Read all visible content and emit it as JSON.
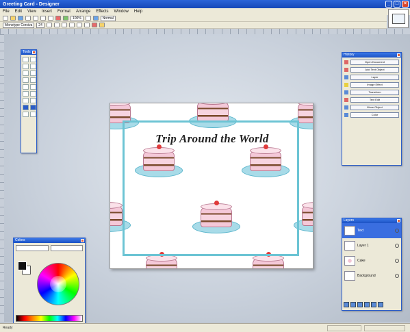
{
  "window": {
    "title": "Greeting Card - Designer",
    "controls": [
      "_",
      "□",
      "×"
    ]
  },
  "menu": [
    "File",
    "Edit",
    "View",
    "Insert",
    "Format",
    "Arrange",
    "Effects",
    "Window",
    "Help"
  ],
  "toolbar": {
    "font_name": "Monotype Corsiva",
    "font_size": "24",
    "zoom": "100%",
    "style": "Normal"
  },
  "canvas": {
    "title_text": "Trip Around the World",
    "frame_color": "#6cc4d4",
    "cake_frosting": "#f4c8d8",
    "plate_color": "#a8dbe8"
  },
  "panels": {
    "tools": {
      "title": "Tools"
    },
    "history": {
      "title": "History",
      "items": [
        {
          "label": "Open Document",
          "icon": "red"
        },
        {
          "label": "Add Text Object",
          "icon": "red"
        },
        {
          "label": "Layer",
          "icon": "blue"
        },
        {
          "label": "Image Effect",
          "icon": "yellow"
        },
        {
          "label": "Transform",
          "icon": "blue"
        },
        {
          "label": "Text Edit",
          "icon": "red"
        },
        {
          "label": "Move Object",
          "icon": "blue"
        },
        {
          "label": "Color",
          "icon": "blue"
        }
      ]
    },
    "colors": {
      "title": "Colors",
      "primary": "#111111",
      "secondary": "#ffffff"
    },
    "layers": {
      "title": "Layers",
      "items": [
        {
          "label": "Text",
          "active": true
        },
        {
          "label": "Layer 1",
          "active": false
        },
        {
          "label": "Cake",
          "active": false
        },
        {
          "label": "Background",
          "active": false
        }
      ]
    }
  },
  "status": {
    "message": "Ready",
    "position": "",
    "size": ""
  }
}
